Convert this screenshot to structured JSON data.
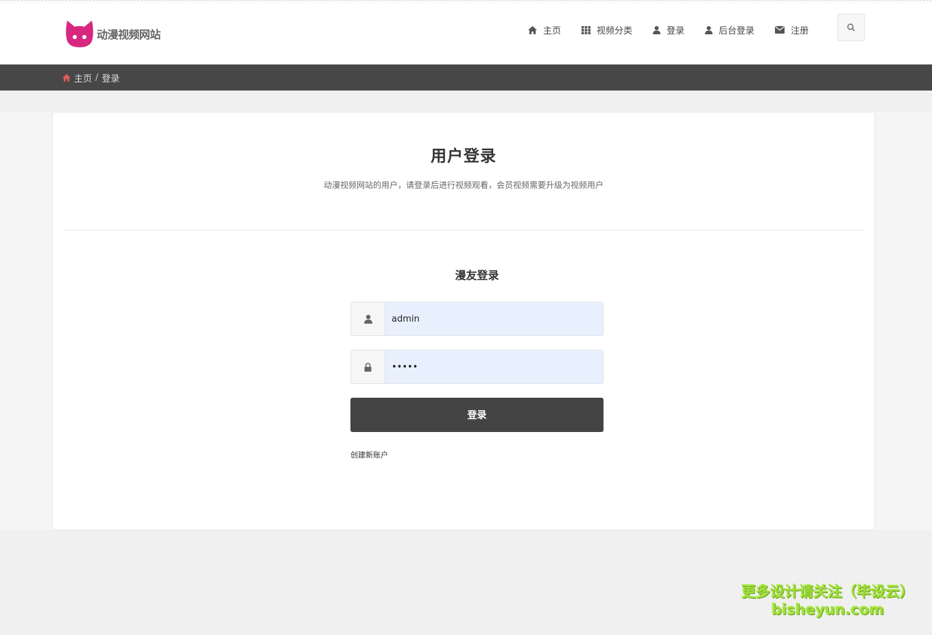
{
  "header": {
    "site_name": "动漫视频网站",
    "nav": [
      {
        "icon": "home-icon",
        "label": "主页"
      },
      {
        "icon": "grid-icon",
        "label": "视频分类"
      },
      {
        "icon": "user-icon",
        "label": "登录"
      },
      {
        "icon": "user-icon",
        "label": "后台登录"
      },
      {
        "icon": "envelope-icon",
        "label": "注册"
      }
    ],
    "search_icon": "search-icon"
  },
  "breadcrumb": {
    "home": "主页",
    "separator": "/",
    "current": "登录"
  },
  "main": {
    "title": "用户登录",
    "subtitle": "动漫视频网站的用户，请登录后进行视频观看，会员视频需要升级为视频用户",
    "form": {
      "title": "漫友登录",
      "username_value": "admin",
      "password_value": "•••••",
      "submit_label": "登录",
      "create_account": "创建新账户"
    }
  },
  "watermark": {
    "line1": "更多设计请关注（毕设云）",
    "line2": "bisheyun.com"
  },
  "colors": {
    "logo": "#d6287f",
    "breadcrumb_bg": "#474747",
    "home_icon": "#e05a5a",
    "button_bg": "#444444",
    "input_bg": "#e8f0fe",
    "watermark": "#9ee03a"
  }
}
